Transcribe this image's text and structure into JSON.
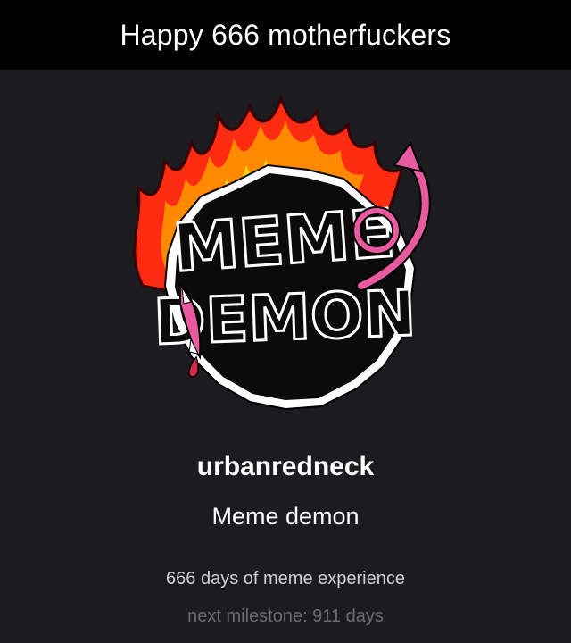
{
  "caption": {
    "text": "Happy 666 motherfuckers"
  },
  "badge": {
    "line1": "MEME",
    "line2": "DEMON",
    "icon": "meme-demon-badge"
  },
  "profile": {
    "username": "urbanredneck",
    "title": "Meme demon",
    "experience": "666 days of meme experience",
    "next_milestone": "next milestone: 911 days"
  },
  "colors": {
    "background": "#1b1b20",
    "caption_bg": "#000000",
    "flame_outer": "#ff2b12",
    "flame_mid": "#ff8a00",
    "flame_inner": "#ffd60a",
    "tail": "#e85aa0",
    "badge_fill": "#0b0b0b"
  }
}
